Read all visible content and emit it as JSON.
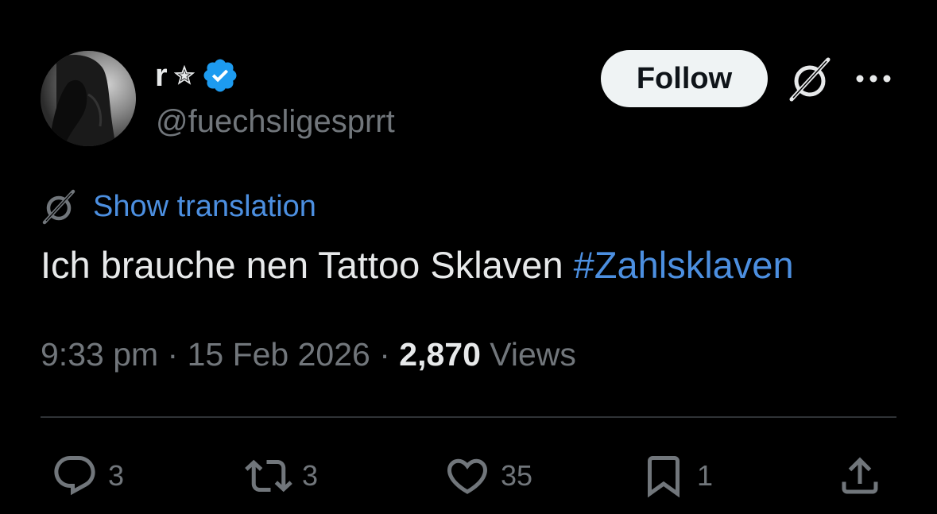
{
  "author": {
    "display_name": "r",
    "handle": "@fuechsligesprrt"
  },
  "header": {
    "follow_label": "Follow"
  },
  "translation": {
    "label": "Show translation"
  },
  "tweet": {
    "text": "Ich brauche nen Tattoo Sklaven ",
    "hashtag": "#Zahlsklaven",
    "time": "9:33 pm",
    "separator1": " · ",
    "date": "15 Feb 2026",
    "separator2": " · ",
    "views_count": "2,870",
    "views_label": " Views"
  },
  "actions": {
    "replies": "3",
    "reposts": "3",
    "likes": "35",
    "bookmarks": "1"
  },
  "colors": {
    "background": "#000000",
    "text_primary": "#e7e9ea",
    "text_secondary": "#71767b",
    "link": "#4c8fe0",
    "verified": "#1d9bf0",
    "divider": "#2f3336"
  },
  "icons": {
    "verified": "verified-badge-icon",
    "star": "star-icon",
    "grok": "grok-icon",
    "more": "more-icon",
    "reply": "reply-icon",
    "repost": "repost-icon",
    "like": "heart-icon",
    "bookmark": "bookmark-icon",
    "share": "share-icon"
  }
}
